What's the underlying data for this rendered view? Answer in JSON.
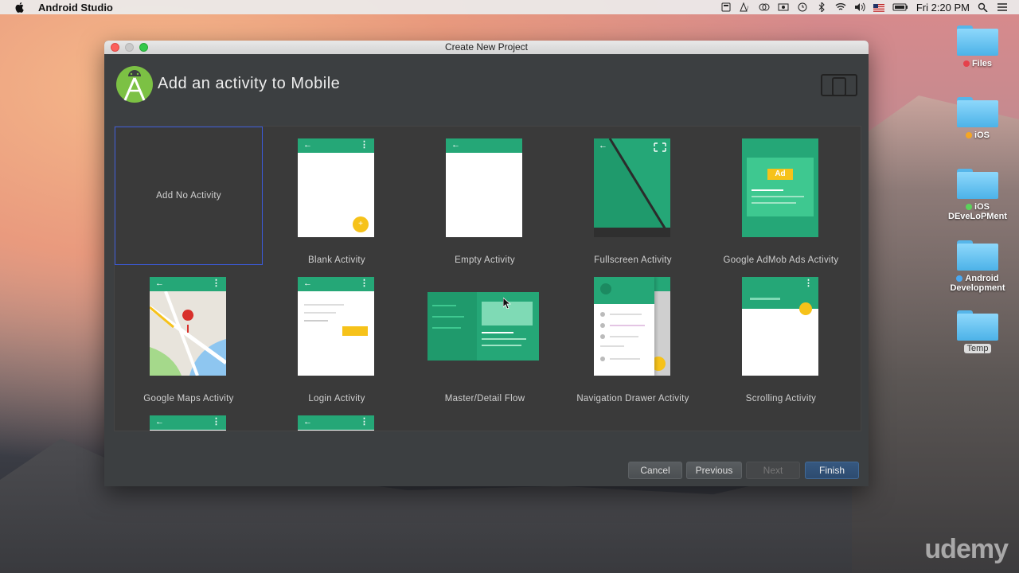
{
  "menubar": {
    "app_name": "Android Studio",
    "clock": "Fri 2:20 PM",
    "status_icons": [
      "battery-charging-icon",
      "adobe-icon",
      "creative-cloud-icon",
      "screen-record-icon",
      "time-machine-icon",
      "bluetooth-icon",
      "wifi-icon",
      "volume-icon",
      "us-flag-icon",
      "battery-icon",
      "spotlight-icon",
      "notification-center-icon"
    ]
  },
  "desktop": {
    "items": [
      {
        "label": "Files",
        "tag_color": "#e5414b"
      },
      {
        "label": "iOS",
        "tag_color": "#f5a623"
      },
      {
        "label": "iOS DEveLoPMent",
        "tag_color": "#5bd35b"
      },
      {
        "label": "Android Development",
        "tag_color": "#4aa8f0"
      },
      {
        "label": "Temp",
        "tag_color": ""
      }
    ]
  },
  "dialog": {
    "window_title": "Create New Project",
    "header_title": "Add an activity to Mobile",
    "activities": [
      {
        "label": "Add No Activity",
        "selected": true
      },
      {
        "label": "Blank Activity"
      },
      {
        "label": "Empty Activity"
      },
      {
        "label": "Fullscreen Activity"
      },
      {
        "label": "Google AdMob Ads Activity",
        "ad_badge": "Ad"
      },
      {
        "label": "Google Maps Activity"
      },
      {
        "label": "Login Activity"
      },
      {
        "label": "Master/Detail Flow"
      },
      {
        "label": "Navigation Drawer Activity"
      },
      {
        "label": "Scrolling Activity"
      }
    ],
    "buttons": {
      "cancel": "Cancel",
      "previous": "Previous",
      "next": "Next",
      "finish": "Finish"
    },
    "colors": {
      "accent_green": "#25a777",
      "fab_yellow": "#f6c21a",
      "selection_border": "#3b5bdb"
    }
  },
  "watermark": "udemy"
}
